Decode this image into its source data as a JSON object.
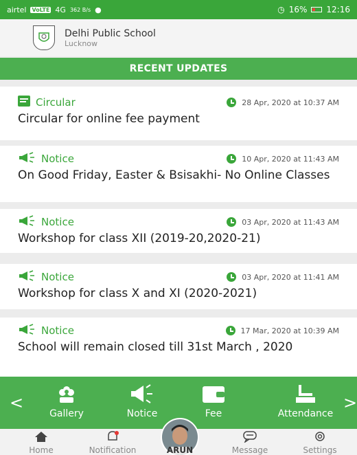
{
  "status_bar": {
    "carrier": "airtel",
    "volte": "VoLTE",
    "network": "4G",
    "speed": "362 B/s",
    "battery": "16%",
    "time": "12:16"
  },
  "school": {
    "name": "Delhi Public School",
    "city": "Lucknow"
  },
  "section_title": "RECENT UPDATES",
  "updates": [
    {
      "type": "Circular",
      "icon": "circular-icon",
      "timestamp": "28 Apr, 2020 at 10:37 AM",
      "title": "Circular for online fee payment"
    },
    {
      "type": "Notice",
      "icon": "megaphone-icon",
      "timestamp": "10 Apr, 2020 at 11:43 AM",
      "title": "On Good Friday, Easter & Bsisakhi- No Online Classes"
    },
    {
      "type": "Notice",
      "icon": "megaphone-icon",
      "timestamp": "03 Apr, 2020 at 11:43 AM",
      "title": "Workshop for class XII (2019-20,2020-21)"
    },
    {
      "type": "Notice",
      "icon": "megaphone-icon",
      "timestamp": "03 Apr, 2020 at 11:41 AM",
      "title": "Workshop for class X and XI (2020-2021)"
    },
    {
      "type": "Notice",
      "icon": "megaphone-icon",
      "timestamp": "17 Mar, 2020 at 10:39 AM",
      "title": "School will remain closed till 31st March , 2020"
    }
  ],
  "quick_links": {
    "prev": "<",
    "next": ">",
    "items": [
      "Gallery",
      "Notice",
      "Fee",
      "Attendance"
    ]
  },
  "bottom_nav": {
    "home": "Home",
    "notification": "Notification",
    "profile": "ARUN",
    "message": "Message",
    "settings": "Settings"
  },
  "colors": {
    "primary": "#4caf50",
    "status_bar": "#3aa63a",
    "background": "#ececec"
  }
}
